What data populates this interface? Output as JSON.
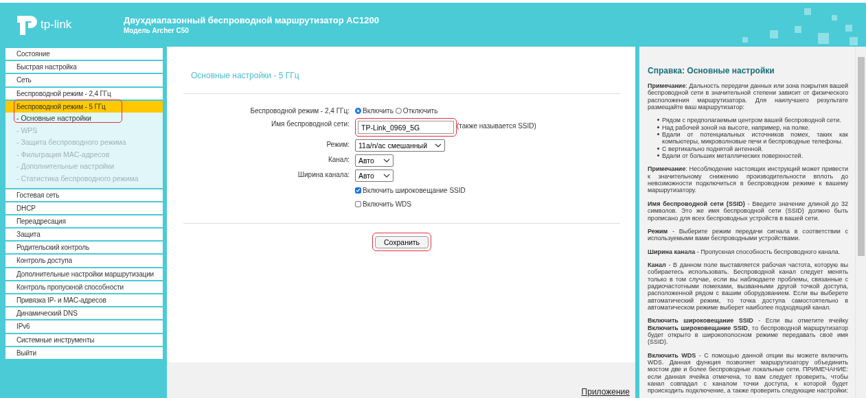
{
  "header": {
    "logo_text": "tp-link",
    "title": "Двухдиапазонный беспроводной маршрутизатор AC1200",
    "model": "Модель Archer C50"
  },
  "nav": [
    {
      "label": "Состояние",
      "selected": false
    },
    {
      "label": "Быстрая настройка",
      "selected": false
    },
    {
      "label": "Сеть",
      "selected": false
    },
    {
      "label": "Беспроводной режим - 2,4 ГГц",
      "selected": false
    },
    {
      "label": "Беспроводной режим - 5 ГГц",
      "selected": true,
      "highlighted": true,
      "children": [
        {
          "label": "- Основные настройки",
          "selected": true
        },
        {
          "label": "- WPS",
          "selected": false
        },
        {
          "label": "- Защита беспроводного режима",
          "selected": false
        },
        {
          "label": "- Фильтрация MAC-адресов",
          "selected": false
        },
        {
          "label": "- Дополнительные настройки",
          "selected": false
        },
        {
          "label": "- Статистика беспроводного режима",
          "selected": false
        }
      ]
    },
    {
      "label": "Гостевая сеть",
      "selected": false
    },
    {
      "label": "DHCP",
      "selected": false
    },
    {
      "label": "Переадресация",
      "selected": false
    },
    {
      "label": "Защита",
      "selected": false
    },
    {
      "label": "Родительский контроль",
      "selected": false
    },
    {
      "label": "Контроль доступа",
      "selected": false
    },
    {
      "label": "Дополнительные настройки маршрутизации",
      "selected": false
    },
    {
      "label": "Контроль пропускной способности",
      "selected": false
    },
    {
      "label": "Привязка IP- и MAC-адресов",
      "selected": false
    },
    {
      "label": "Динамический DNS",
      "selected": false
    },
    {
      "label": "IPv6",
      "selected": false
    },
    {
      "label": "Системные инструменты",
      "selected": false
    },
    {
      "label": "Выйти",
      "selected": false
    }
  ],
  "main": {
    "title": "Основные настройки - 5 ГГц",
    "rows": [
      {
        "kind": "radio",
        "label": "Беспроводной режим - 2,4 ГГц:",
        "options": [
          {
            "label": "Включить",
            "selected": true
          },
          {
            "label": "Отключить",
            "selected": false
          }
        ]
      },
      {
        "kind": "text",
        "label": "Имя беспроводной сети:",
        "value": "TP-Link_0969_5G",
        "note": "(также называется SSID)",
        "highlighted": true
      },
      {
        "kind": "select",
        "label": "Режим:",
        "value": "11a/n/ac смешанный",
        "wide": true
      },
      {
        "kind": "select",
        "label": "Канал:",
        "value": "Авто",
        "wide": false
      },
      {
        "kind": "select",
        "label": "Ширина канала:",
        "value": "Авто",
        "wide": false
      },
      {
        "kind": "checkbox",
        "label": "Включить широковещание SSID",
        "checked": true
      },
      {
        "kind": "checkbox",
        "label": "Включить WDS",
        "checked": false
      }
    ],
    "save_button": {
      "label": "Сохранить",
      "highlighted": true
    },
    "footer_link": "Приложение"
  },
  "help": {
    "title": "Справка: Основные настройки",
    "blocks": [
      {
        "kind": "para",
        "text": "**Примечание**: Дальность передачи данных или зона покрытия вашей беспроводной сети в значительной степени зависит от физического расположения маршрутизатора. Для наилучшего результате размещайте ваш маршрутизатор:"
      },
      {
        "kind": "list",
        "items": [
          "Рядом с предполагаемым центром вашей беспроводной сети.",
          "Над рабочей зоной на высоте, например, на полке.",
          "Вдали от потенциальных источников помех, таких как компьютеры, микроволновые печи и беспроводные телефоны.",
          "С вертикально поднятой антенной.",
          "Вдали от больших металлических поверхностей."
        ]
      },
      {
        "kind": "para",
        "text": "**Примечание**: Несоблюдение настоящих инструкций может привести к значительному снижению производительности вплоть до невозможности подключиться в беспроводном режиме к вашему маршрутизатору."
      },
      {
        "kind": "para",
        "text": "**Имя беспроводной сети (SSID)** - Введите значение длиной до 32 символов. Это же имя беспроводной сети (SSID) должно быть прописано для всех беспроводных устройств в вашей сети."
      },
      {
        "kind": "para",
        "text": "**Режим** - Выберите режим передачи сигнала в соответствии с используемыми вами беспроводными устройствами."
      },
      {
        "kind": "para",
        "text": "**Ширина канала** - Пропускная способность беспроводного канала."
      },
      {
        "kind": "para",
        "text": "**Канал** - В данном поле выставляется рабочая частота, которую вы собираетесь использовать. Беспроводной канал следует менять только в том случае, если вы наблюдаете проблемы, связанные с радиочастотными помехами, вызванными другой точкой доступа, расположенной рядом с вашим оборудованием. Если вы выберете автоматический режим, то точка доступа самостоятельно в автоматическом режиме выберет наиболее подходящий канал."
      },
      {
        "kind": "para",
        "text": "**Включить широковещание SSID** - Если вы отметите ячейку **Включить широковещание SSID**, то беспроводной маршрутизатор будет открыто в широкополосном режиме передавать своё имя (SSID)."
      },
      {
        "kind": "para",
        "text": "**Включить WDS** - С помощью данной опции вы можете включить WDS. Данная функция позволяет маршрутизатору объединить мостом две и более беспроводные локальные сети. ПРИМЕЧАНИЕ: если данная ячейка отмечена, то вам следует проверить, чтобы канал совпадал с каналом точки доступа, к которой будет происходить подключение, а также проверить следующие настройки:"
      }
    ]
  }
}
